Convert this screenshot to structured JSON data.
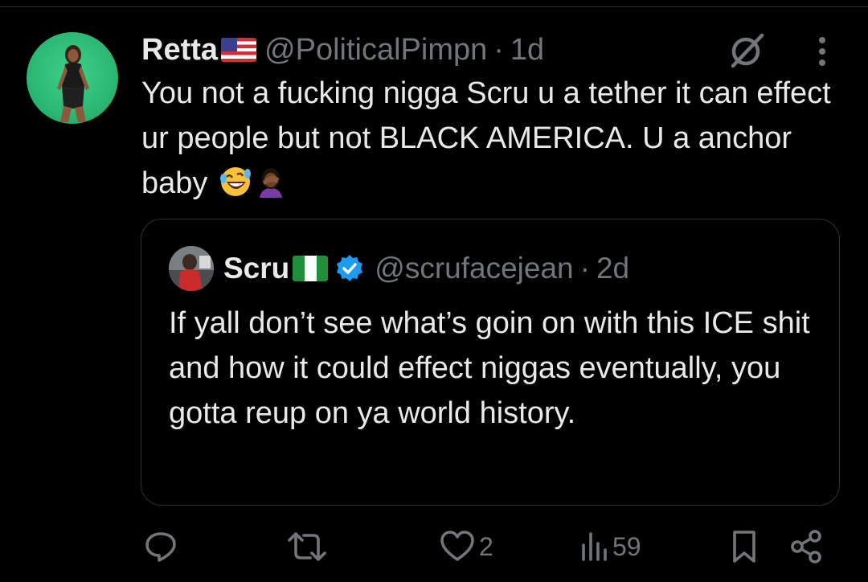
{
  "tweet": {
    "display_name": "Retta",
    "flag_icon": "us-flag-icon",
    "handle": "@PoliticalPimpn",
    "separator": "·",
    "time": "1d",
    "text": "You not a fucking nigga Scru u a tether it can effect ur people but not BLACK AMERICA. U a anchor baby",
    "emojis": [
      "rolling-on-floor-laughing-emoji",
      "facepalm-emoji"
    ]
  },
  "quote": {
    "display_name": "Scru",
    "flag_icon": "nigeria-flag-icon",
    "verified": true,
    "handle": "@scrufacejean",
    "separator": "·",
    "time": "2d",
    "text": "If yall don’t see what’s goin on with this ICE shit and how it could effect niggas eventually, you gotta reup on ya world history."
  },
  "actions": {
    "reply_count": "",
    "repost_count": "",
    "like_count": "2",
    "view_count": "59"
  },
  "colors": {
    "background": "#000000",
    "text": "#e7e9ea",
    "secondary": "#71767b",
    "border": "#2f3336",
    "verified": "#1d9bf0"
  }
}
